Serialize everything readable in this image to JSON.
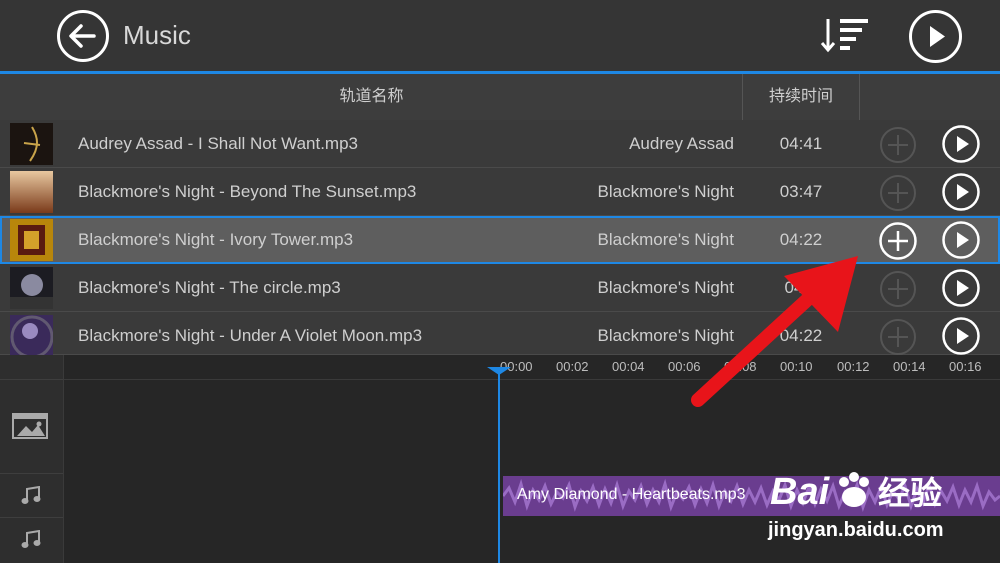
{
  "header": {
    "title": "Music"
  },
  "table": {
    "col_name": "轨道名称",
    "col_duration": "持续时间"
  },
  "tracks": [
    {
      "name": "Audrey Assad - I Shall Not Want.mp3",
      "artist": "Audrey Assad",
      "duration": "04:41"
    },
    {
      "name": "Blackmore's Night - Beyond The Sunset.mp3",
      "artist": "Blackmore's Night",
      "duration": "03:47"
    },
    {
      "name": "Blackmore's Night - Ivory Tower.mp3",
      "artist": "Blackmore's Night",
      "duration": "04:22"
    },
    {
      "name": "Blackmore's Night - The circle.mp3",
      "artist": "Blackmore's Night",
      "duration": "04:4"
    },
    {
      "name": "Blackmore's Night - Under A Violet Moon.mp3",
      "artist": "Blackmore's Night",
      "duration": "04:22"
    }
  ],
  "timeline": {
    "ticks": [
      "00:00",
      "00:02",
      "00:04",
      "00:06",
      "00:08",
      "00:10",
      "00:12",
      "00:14",
      "00:16"
    ],
    "clip_label": "Amy Diamond - Heartbeats.mp3"
  },
  "watermark": {
    "brand": "Bai",
    "brand2": "经验",
    "url": "jingyan.baidu.com"
  },
  "colors": {
    "accent": "#1e88e5",
    "clip": "#6a3d8f",
    "arrow": "#e8141a"
  }
}
